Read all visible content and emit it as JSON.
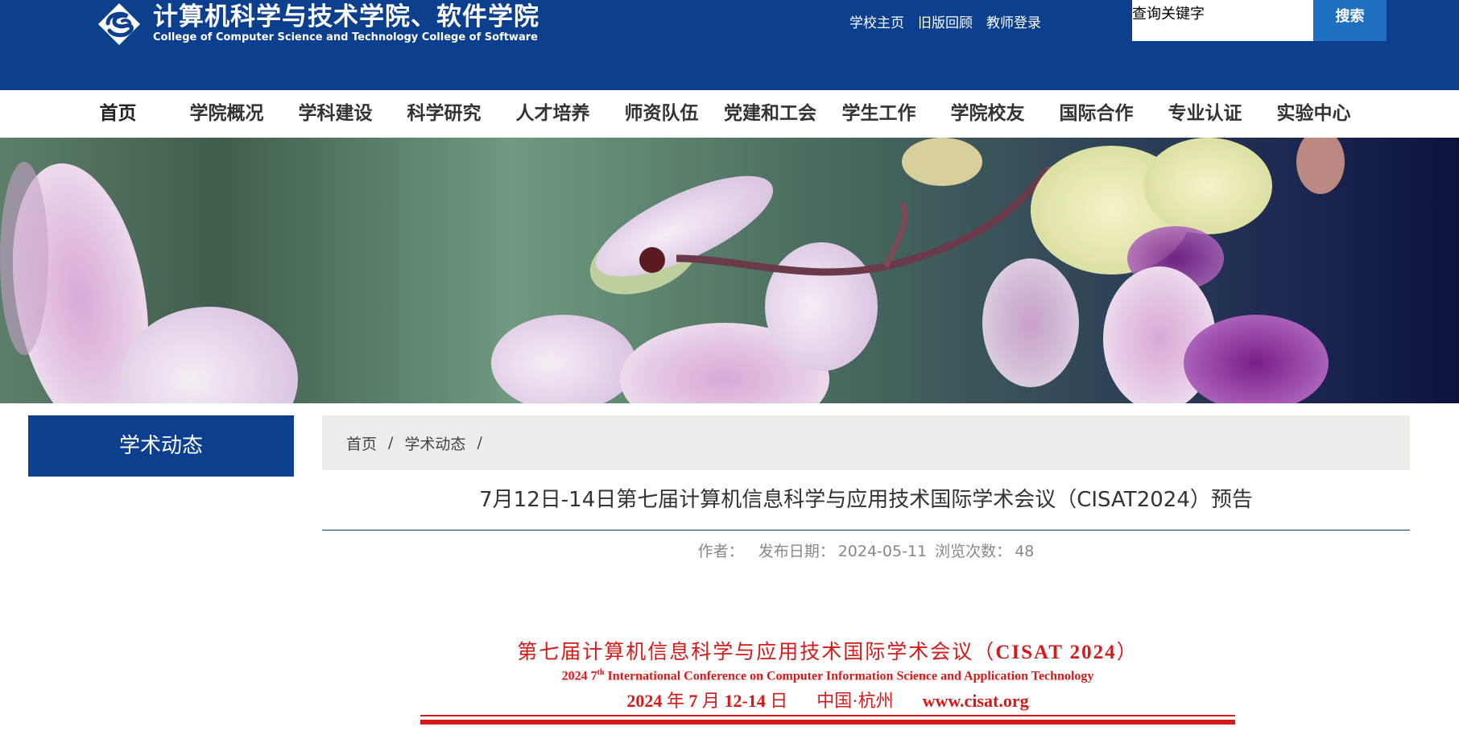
{
  "header": {
    "logo_cn": "计算机科学与技术学院、软件学院",
    "logo_en": "College of Computer Science and Technology  College of Software",
    "links": [
      "学校主页",
      "旧版回顾",
      "教师登录"
    ],
    "search": {
      "placeholder": "查询关键字",
      "button": "搜索"
    }
  },
  "nav": {
    "items": [
      "首页",
      "学院概况",
      "学科建设",
      "科学研究",
      "人才培养",
      "师资队伍",
      "党建和工会",
      "学生工作",
      "学院校友",
      "国际合作",
      "专业认证",
      "实验中心"
    ],
    "active": "首页"
  },
  "sidebar": {
    "title": "学术动态"
  },
  "breadcrumb": {
    "home": "首页",
    "section": "学术动态",
    "sep": "/"
  },
  "article": {
    "title": "7月12日-14日第七届计算机信息科学与应用技术国际学术会议（CISAT2024）预告",
    "meta": {
      "author_label": "作者：",
      "date_label": "发布日期：",
      "date": "2024-05-11",
      "views_label": "浏览次数：",
      "views": "48"
    }
  },
  "poster": {
    "title_cn": "第七届计算机信息科学与应用技术国际学术会议（",
    "title_code": "CISAT 2024",
    "title_close": "）",
    "en_pre": "2024 7",
    "en_sup": "th",
    "en_post": " International Conference on Computer Information Science and Application Technology",
    "date_year": "2024",
    "date_yr_char": " 年 ",
    "date_month": "7",
    "date_mo_char": " 月 ",
    "date_days": "12-14",
    "date_day_char": " 日",
    "location": "中国·杭州",
    "website": "www.cisat.org"
  },
  "colors": {
    "header_bg": "#0d3f8f",
    "search_btn": "#1e6fc0",
    "breadcrumb_bg": "#eeedea",
    "poster_red": "#d61a1a"
  }
}
